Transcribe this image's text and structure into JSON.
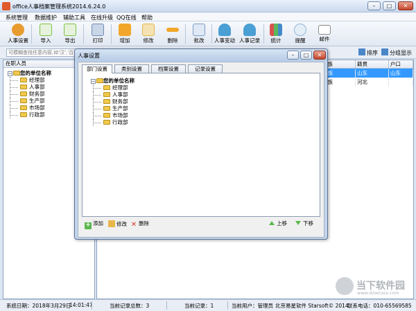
{
  "window": {
    "title": "office人事档案管理系统2014.6.24.0",
    "min": "–",
    "max": "□",
    "close": "✕"
  },
  "menu": [
    "系统管理",
    "数据维护",
    "辅助工具",
    "在线升级",
    "QQ在线",
    "帮助"
  ],
  "toolbar": [
    {
      "label": "人事设置",
      "icon": "gear-icon",
      "color": "#e89b2e"
    },
    {
      "label": "导入",
      "icon": "import-icon",
      "color": "#7ac143"
    },
    {
      "label": "导出",
      "icon": "export-icon",
      "color": "#7ac143"
    },
    {
      "label": "打印",
      "icon": "printer-icon",
      "color": "#6d8bb3"
    },
    {
      "label": "增加",
      "icon": "add-icon",
      "color": "#f2a72b"
    },
    {
      "label": "修改",
      "icon": "edit-icon",
      "color": "#e3b64a"
    },
    {
      "label": "删除",
      "icon": "minus-icon",
      "color": "#f2a72b"
    },
    {
      "label": "批改",
      "icon": "batch-edit-icon",
      "color": "#7a9ccb"
    },
    {
      "label": "人事变动",
      "icon": "person-change-icon",
      "color": "#4a9fd4"
    },
    {
      "label": "人事记录",
      "icon": "person-record-icon",
      "color": "#4a9fd4"
    },
    {
      "label": "统计",
      "icon": "chart-icon",
      "color": "#d9534f"
    },
    {
      "label": "提醒",
      "icon": "alarm-clock-icon",
      "color": "#8fb7d9"
    },
    {
      "label": "邮件",
      "icon": "mail-icon",
      "color": "#ffffff"
    }
  ],
  "search": {
    "placeholder": "可模糊查找任意内容,如'汉','百'..."
  },
  "sort_label": "排序",
  "group_label": "分组显示",
  "left": {
    "header": "在职人员",
    "root": "您的单位名称",
    "departments": [
      "经理部",
      "人事部",
      "财务部",
      "生产部",
      "市场部",
      "行政部"
    ]
  },
  "grid": {
    "columns": [
      "民族",
      "籍贯",
      "户口"
    ],
    "rows": [
      [
        "汉族",
        "山东",
        "山东"
      ],
      [
        "汉族",
        "河北",
        ""
      ]
    ]
  },
  "dialog": {
    "title": "人事设置",
    "tabs": [
      "部门设置",
      "类别设置",
      "档案设置",
      "记录设置"
    ],
    "active_tab": 0,
    "root": "您的单位名称",
    "departments": [
      "经理部",
      "人事部",
      "财务部",
      "生产部",
      "市场部",
      "行政部"
    ],
    "actions": {
      "add": "添加",
      "edit": "修改",
      "delete": "删除",
      "up": "上移",
      "down": "下移"
    }
  },
  "status": {
    "date": "系统日期：2018年3月29日",
    "time": "14:01:47",
    "total": "当前记录总数：3",
    "current": "当前记录：1",
    "user": "当前用户：管理员",
    "copyright": "北京易星软件 Starsoft© 2014",
    "phone": "联系电话：010-65569585"
  },
  "watermark": {
    "text": "当下软件园",
    "url": "www.downxia.com"
  }
}
